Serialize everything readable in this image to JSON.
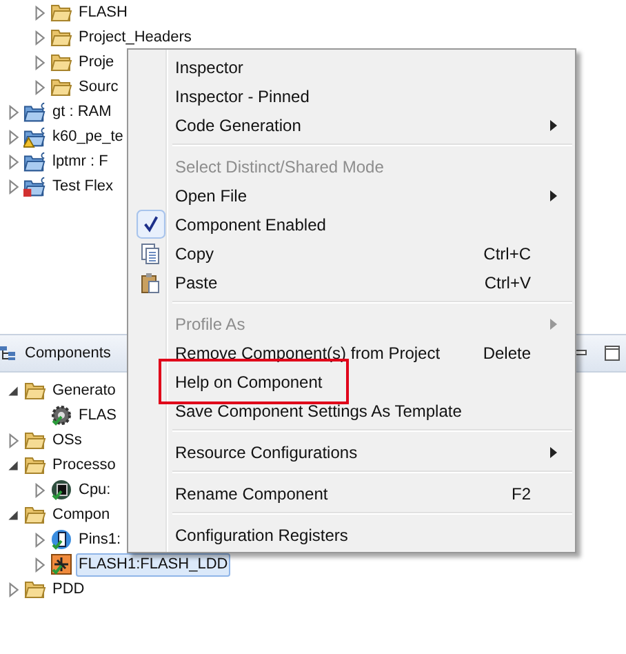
{
  "project_tree": {
    "continued_children": [
      {
        "label": "FLASH",
        "kind": "folder",
        "expanded": false,
        "selected": false
      },
      {
        "label": "Project_Headers",
        "kind": "folder",
        "expanded": false,
        "selected": false
      },
      {
        "label": "Proje",
        "kind": "folder",
        "expanded": false,
        "selected": false
      },
      {
        "label": "Sourc",
        "kind": "folder",
        "expanded": false,
        "selected": false
      }
    ],
    "items": [
      {
        "label": "gt : RAM",
        "kind": "project",
        "expanded": false,
        "selected": false
      },
      {
        "label": "k60_pe_te",
        "kind": "warnproject",
        "expanded": false,
        "selected": false
      },
      {
        "label": "lptmr : F",
        "kind": "project",
        "expanded": false,
        "selected": false
      },
      {
        "label": "Test Flex",
        "kind": "errorproject",
        "expanded": false,
        "selected": false
      }
    ]
  },
  "components_panel": {
    "title": "Components",
    "items": [
      {
        "label": "Generato",
        "kind": "folder",
        "expanded": true,
        "selected": false,
        "children": [
          {
            "label": "FLAS",
            "kind": "gear",
            "selected": false
          }
        ]
      },
      {
        "label": "OSs",
        "kind": "folder",
        "expanded": false,
        "selected": false
      },
      {
        "label": "Processo",
        "kind": "folder",
        "expanded": true,
        "selected": false,
        "children": [
          {
            "label": "Cpu:",
            "kind": "cpu",
            "expanded": false,
            "selected": false
          }
        ]
      },
      {
        "label": "Compon",
        "kind": "folder",
        "expanded": true,
        "selected": false,
        "children": [
          {
            "label": "Pins1:",
            "kind": "pins",
            "expanded": false,
            "selected": false
          },
          {
            "label": "FLASH1:FLASH_LDD",
            "kind": "component",
            "expanded": false,
            "selected": true
          }
        ]
      },
      {
        "label": "PDD",
        "kind": "folder",
        "expanded": false,
        "selected": false
      }
    ]
  },
  "context_menu": {
    "items": [
      {
        "kind": "item",
        "label": "Inspector",
        "disabled": false,
        "submenu": false
      },
      {
        "kind": "item",
        "label": "Inspector - Pinned",
        "disabled": false,
        "submenu": false
      },
      {
        "kind": "item",
        "label": "Code Generation",
        "disabled": false,
        "submenu": true
      },
      {
        "kind": "separator"
      },
      {
        "kind": "item",
        "label": "Select Distinct/Shared Mode",
        "disabled": true,
        "submenu": false
      },
      {
        "kind": "item",
        "label": "Open File",
        "disabled": false,
        "submenu": true
      },
      {
        "kind": "item",
        "label": "Component Enabled",
        "disabled": false,
        "submenu": false,
        "checked": true
      },
      {
        "kind": "copy",
        "label": "Copy",
        "disabled": false,
        "submenu": false,
        "shortcut": "Ctrl+C"
      },
      {
        "kind": "paste",
        "label": "Paste",
        "disabled": false,
        "submenu": false,
        "shortcut": "Ctrl+V"
      },
      {
        "kind": "separator"
      },
      {
        "kind": "item",
        "label": "Profile As",
        "disabled": true,
        "submenu": true
      },
      {
        "kind": "item",
        "label": "Remove Component(s) from Project",
        "disabled": false,
        "submenu": false,
        "shortcut": "Delete"
      },
      {
        "kind": "item",
        "label": "Help on Component",
        "disabled": false,
        "submenu": false,
        "highlighted": true
      },
      {
        "kind": "item",
        "label": "Save Component Settings As Template",
        "disabled": false,
        "submenu": false
      },
      {
        "kind": "separator"
      },
      {
        "kind": "item",
        "label": "Resource Configurations",
        "disabled": false,
        "submenu": true
      },
      {
        "kind": "separator"
      },
      {
        "kind": "item",
        "label": "Rename Component",
        "disabled": false,
        "submenu": false,
        "shortcut": "F2"
      },
      {
        "kind": "separator"
      },
      {
        "kind": "item",
        "label": "Configuration Registers",
        "disabled": false,
        "submenu": false
      }
    ]
  }
}
